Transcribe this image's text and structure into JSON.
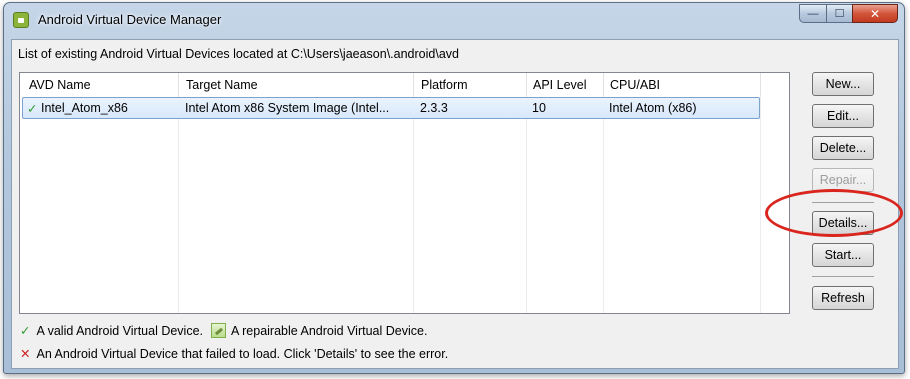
{
  "window": {
    "title": "Android Virtual Device Manager",
    "controls": {
      "minimize": "—",
      "maximize": "☐",
      "close": "✕"
    }
  },
  "header": {
    "text": "List of existing Android Virtual Devices located at C:\\Users\\jaeason\\.android\\avd"
  },
  "table": {
    "columns": [
      "AVD Name",
      "Target Name",
      "Platform",
      "API Level",
      "CPU/ABI"
    ],
    "rows": [
      {
        "status_icon": "check-icon",
        "name": "Intel_Atom_x86",
        "target": "Intel Atom x86 System Image (Intel...",
        "platform": "2.3.3",
        "api_level": "10",
        "cpu_abi": "Intel Atom (x86)"
      }
    ]
  },
  "buttons": {
    "new": "New...",
    "edit": "Edit...",
    "delete": "Delete...",
    "repair": "Repair...",
    "details": "Details...",
    "start": "Start...",
    "refresh": "Refresh"
  },
  "legend": {
    "valid": "A valid Android Virtual Device.",
    "repairable": "A repairable Android Virtual Device.",
    "failed": "An Android Virtual Device that failed to load. Click 'Details' to see the error."
  },
  "icons": {
    "valid": "✓",
    "failed": "✕"
  },
  "colors": {
    "highlight": "#d9251d",
    "valid": "#2f9a2f",
    "error": "#d02020",
    "selection": "#d8e8fb"
  }
}
